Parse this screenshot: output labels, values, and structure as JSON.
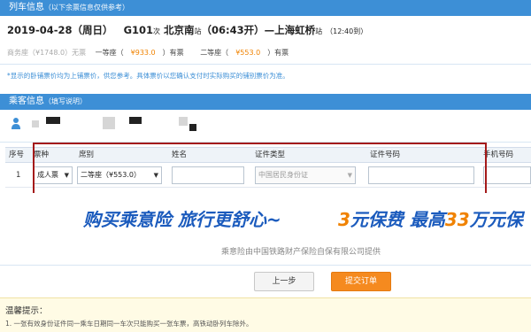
{
  "train_info": {
    "section_title": "列车信息",
    "section_note": "（以下余票信息仅供参考）",
    "date": "2019-04-28（周日）",
    "train_no": "G101",
    "train_suffix": "次",
    "from_station": "北京南",
    "from_suffix": "站",
    "depart_time": "（06:43开）",
    "dash": "—",
    "to_station": "上海虹桥",
    "to_suffix": "站",
    "arrive_time": "（12:40到）",
    "seats": [
      {
        "label": "商务座（¥1748.0）无票",
        "available": false
      },
      {
        "label": "一等座（",
        "price": "¥933.0",
        "status": "）有票",
        "available": true
      },
      {
        "label": "二等座（",
        "price": "¥553.0",
        "status": "）有票",
        "available": true
      }
    ],
    "notice": "*显示的卧铺票价均为上铺票价，供您参考。具体票价以您确认支付时实际购买的铺别票价为准。"
  },
  "passenger_info": {
    "section_title": "乘客信息",
    "section_note": "（填写说明）"
  },
  "form": {
    "headers": {
      "index": "序号",
      "ticket_type": "票种",
      "seat_class": "席别",
      "name": "姓名",
      "id_type": "证件类型",
      "id_number": "证件号码",
      "phone": "手机号码"
    },
    "row": {
      "index": "1",
      "ticket_type": "成人票",
      "seat_class": "二等座（¥553.0）",
      "name": "",
      "id_type": "中国居民身份证",
      "id_number": ""
    }
  },
  "banner": {
    "part1": "购买乘意险  旅行更舒心~",
    "part2_a": "3",
    "part2_b": "元保费  最高",
    "part2_c": "33",
    "part2_d": "万元保",
    "sub": "乘意险由中国铁路财产保险自保有限公司提供"
  },
  "buttons": {
    "prev": "上一步",
    "submit": "提交订单"
  },
  "tips": {
    "title": "温馨提示：",
    "line1": "1. 一张有效身份证件同一乘车日期同一车次只能购买一张车票，高铁动卧列车除外。"
  },
  "colors": {
    "accent_blue": "#3d8fd6",
    "price_orange": "#f08200",
    "highlight_red": "#a41a1a",
    "submit_orange": "#f58a1f"
  }
}
